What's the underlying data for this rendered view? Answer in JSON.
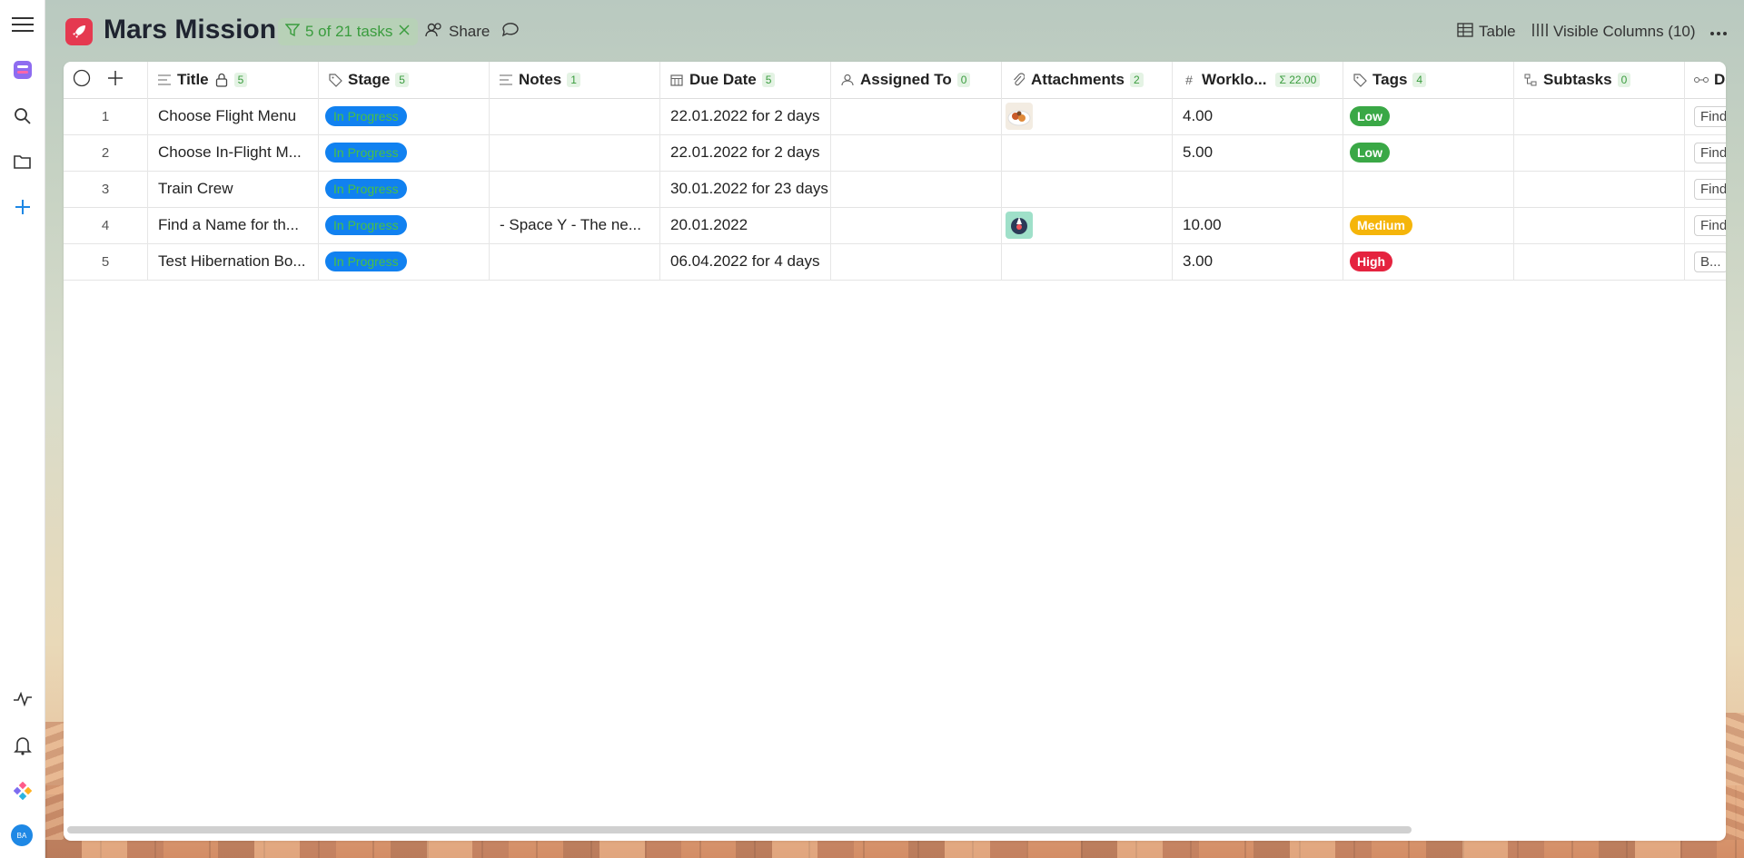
{
  "header": {
    "title": "Mars Mission",
    "filter_label": "5 of 21 tasks",
    "share_label": "Share",
    "view_label": "Table",
    "columns_label": "Visible Columns (10)"
  },
  "columns": {
    "title": {
      "label": "Title",
      "count": "5"
    },
    "stage": {
      "label": "Stage",
      "count": "5"
    },
    "notes": {
      "label": "Notes",
      "count": "1"
    },
    "due": {
      "label": "Due Date",
      "count": "5"
    },
    "assigned": {
      "label": "Assigned To",
      "count": "0"
    },
    "attachments": {
      "label": "Attachments",
      "count": "2"
    },
    "workload": {
      "label": "Worklo...",
      "sum": "22.00"
    },
    "tags": {
      "label": "Tags",
      "count": "4"
    },
    "subtasks": {
      "label": "Subtasks",
      "count": "0"
    },
    "dependencies": {
      "label": "De"
    }
  },
  "rows": [
    {
      "num": "1",
      "title": "Choose Flight Menu",
      "stage": "In Progress",
      "notes": "",
      "due": "22.01.2022 for 2 days",
      "workload": "4.00",
      "tag": "Low",
      "dep": "Find"
    },
    {
      "num": "2",
      "title": "Choose In-Flight M...",
      "stage": "In Progress",
      "notes": "",
      "due": "22.01.2022 for 2 days",
      "workload": "5.00",
      "tag": "Low",
      "dep": "Find"
    },
    {
      "num": "3",
      "title": "Train Crew",
      "stage": "In Progress",
      "notes": "",
      "due": "30.01.2022 for 23 days",
      "workload": "",
      "tag": "",
      "dep": "Find"
    },
    {
      "num": "4",
      "title": "Find a Name for th...",
      "stage": "In Progress",
      "notes": "- Space Y - The ne...",
      "due": "20.01.2022",
      "workload": "10.00",
      "tag": "Medium",
      "dep": "Find"
    },
    {
      "num": "5",
      "title": "Test Hibernation Bo...",
      "stage": "In Progress",
      "notes": "",
      "due": "06.04.2022 for 4 days",
      "workload": "3.00",
      "tag": "High",
      "dep": "B..."
    }
  ],
  "colors": {
    "accent": "#1181f0",
    "low": "#3aa846",
    "medium": "#f5b50a",
    "high": "#e5233f",
    "logo": "#e53950"
  },
  "avatar_initials": "BA"
}
